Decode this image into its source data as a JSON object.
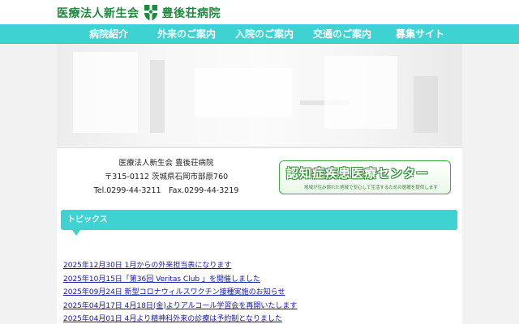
{
  "header": {
    "logo_left": "医療法人新生会",
    "logo_right": "豊後荘病院"
  },
  "nav": {
    "items": [
      {
        "label": "病院紹介"
      },
      {
        "label": "外来のご案内"
      },
      {
        "label": "入院のご案内"
      },
      {
        "label": "交通のご案内"
      },
      {
        "label": "募集サイト"
      }
    ]
  },
  "address": {
    "name": "医療法人新生会 豊後荘病院",
    "postal": "〒315-0112 茨城県石岡市部原760",
    "phone": "Tel.0299-44-3211　Fax.0299-44-3219"
  },
  "banner": {
    "title": "認知症疾患医療センター",
    "subtitle": "地域が住み慣れた地域で安心して生活するための医療を提供します"
  },
  "topics": {
    "title": "トピックス",
    "items": [
      {
        "text": "2025年12月30日 1月からの外来担当表になります"
      },
      {
        "text": "2025年10月15日「第36回 Veritas Club 」を開催しました"
      },
      {
        "text": "2025年09月24日 新型コロナウィルスワクチン接種実施のお知らせ"
      },
      {
        "text": "2025年04月17日 4月18日(金)よりアルコール学習会を再開いたします"
      },
      {
        "text": "2025年04月01日 4月より精神科外来の診療は予約制となりました"
      }
    ]
  },
  "colors": {
    "nav_bg": "#3fd2d2",
    "logo_green": "#1e8a3e",
    "link": "#1515aa",
    "banner_green": "#46a64a"
  },
  "icons": {
    "logo": "shield-cross-icon"
  }
}
